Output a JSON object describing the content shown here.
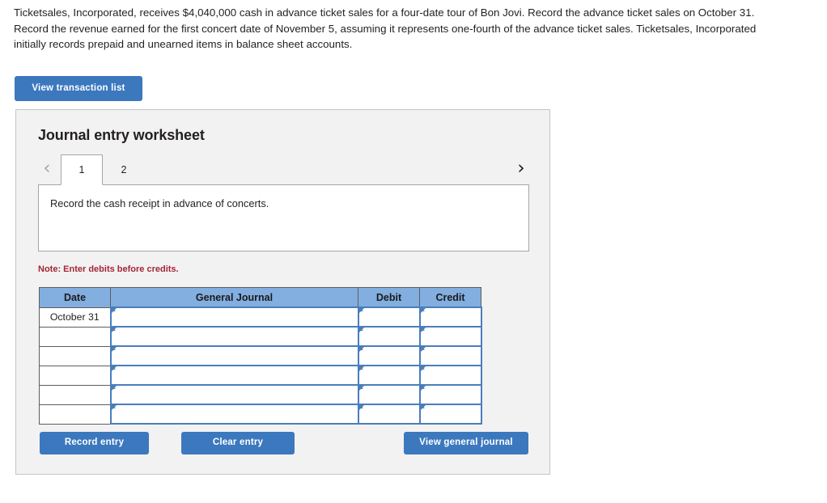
{
  "problem": {
    "statement": "Ticketsales, Incorporated, receives $4,040,000 cash in advance ticket sales for a four-date tour of Bon Jovi. Record the advance ticket sales on October 31. Record the revenue earned for the first concert date of November 5, assuming it represents one-fourth of the advance ticket sales. Ticketsales, Incorporated initially records prepaid and unearned items in balance sheet accounts."
  },
  "toolbar": {
    "view_transaction_list_label": "View transaction list"
  },
  "worksheet": {
    "title": "Journal entry worksheet",
    "nav": {
      "prev_icon": "chevron-left-icon",
      "next_icon": "chevron-right-icon",
      "prev_glyph": "‹",
      "next_glyph": "›",
      "prev_disabled": true
    },
    "tabs": [
      {
        "label": "1",
        "active": true
      },
      {
        "label": "2",
        "active": false
      }
    ],
    "description": "Record the cash receipt in advance of concerts.",
    "note": "Note: Enter debits before credits.",
    "table": {
      "columns": [
        "Date",
        "General Journal",
        "Debit",
        "Credit"
      ],
      "rows": [
        {
          "date": "October 31",
          "general_journal": "",
          "debit": "",
          "credit": ""
        },
        {
          "date": "",
          "general_journal": "",
          "debit": "",
          "credit": ""
        },
        {
          "date": "",
          "general_journal": "",
          "debit": "",
          "credit": ""
        },
        {
          "date": "",
          "general_journal": "",
          "debit": "",
          "credit": ""
        },
        {
          "date": "",
          "general_journal": "",
          "debit": "",
          "credit": ""
        },
        {
          "date": "",
          "general_journal": "",
          "debit": "",
          "credit": ""
        }
      ]
    },
    "actions": {
      "record_entry_label": "Record entry",
      "clear_entry_label": "Clear entry",
      "view_general_journal_label": "View general journal"
    }
  },
  "colors": {
    "button_blue": "#3c78be",
    "table_header_blue": "#82aee0",
    "cell_border_blue": "#4a7ebb",
    "note_red": "#a32638",
    "panel_bg": "#f2f2f2",
    "panel_border": "#c5c5c5"
  }
}
